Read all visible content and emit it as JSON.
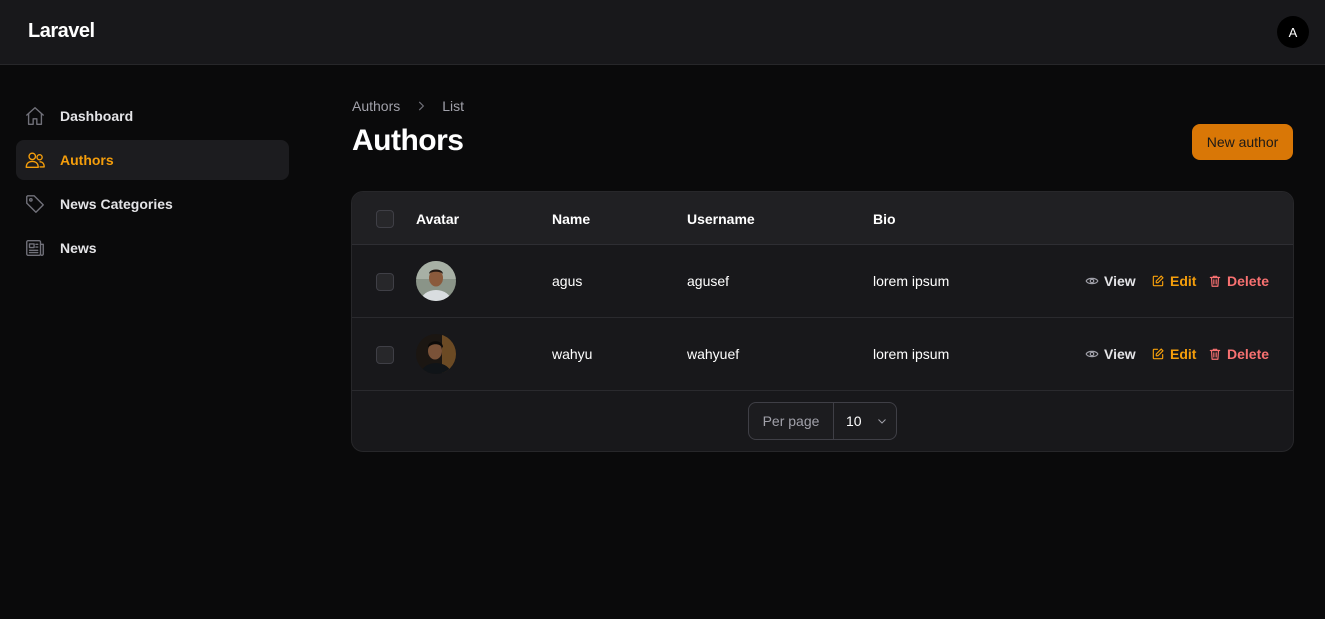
{
  "app": {
    "brand": "Laravel",
    "user_initial": "A"
  },
  "sidebar": {
    "items": [
      {
        "label": "Dashboard",
        "icon": "home-icon",
        "active": false
      },
      {
        "label": "Authors",
        "icon": "users-icon",
        "active": true
      },
      {
        "label": "News Categories",
        "icon": "tag-icon",
        "active": false
      },
      {
        "label": "News",
        "icon": "newspaper-icon",
        "active": false
      }
    ]
  },
  "breadcrumb": {
    "items": [
      "Authors",
      "List"
    ]
  },
  "page": {
    "title": "Authors",
    "new_button": "New author"
  },
  "table": {
    "columns": [
      "Avatar",
      "Name",
      "Username",
      "Bio"
    ],
    "rows": [
      {
        "name": "agus",
        "username": "agusef",
        "bio": "lorem ipsum"
      },
      {
        "name": "wahyu",
        "username": "wahyuef",
        "bio": "lorem ipsum"
      }
    ],
    "actions": {
      "view": "View",
      "edit": "Edit",
      "delete": "Delete"
    },
    "pagination": {
      "per_page_label": "Per page",
      "per_page_value": "10"
    }
  },
  "colors": {
    "accent": "#f59e0b",
    "danger": "#f87171",
    "primary_button": "#d97706"
  }
}
